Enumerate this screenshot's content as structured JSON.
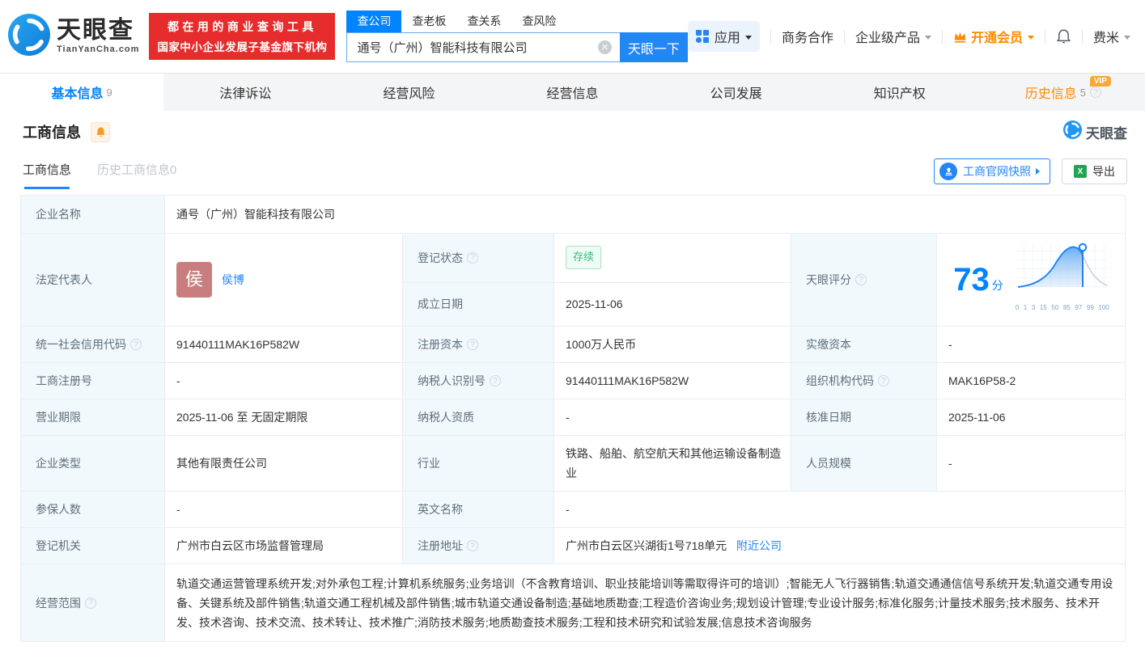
{
  "header": {
    "logo": {
      "brand": "天眼查",
      "domain": "TianYanCha.com"
    },
    "promo": {
      "line1": "都在用的商业查询工具",
      "line2": "国家中小企业发展子基金旗下机构"
    },
    "search": {
      "tabs": [
        {
          "label": "查公司"
        },
        {
          "label": "查老板"
        },
        {
          "label": "查关系"
        },
        {
          "label": "查风险"
        }
      ],
      "input_value": "通号（广州）智能科技有限公司",
      "button_label": "天眼一下"
    },
    "menu": {
      "apps": "应用",
      "cooperation": "商务合作",
      "enterprise": "企业级产品",
      "vip": "开通会员",
      "username": "费米"
    }
  },
  "nav_tabs": [
    {
      "label": "基本信息",
      "count": "9"
    },
    {
      "label": "法律诉讼"
    },
    {
      "label": "经营风险"
    },
    {
      "label": "经营信息"
    },
    {
      "label": "公司发展"
    },
    {
      "label": "知识产权"
    },
    {
      "label": "历史信息",
      "count": "5",
      "vip_badge": "VIP"
    }
  ],
  "section": {
    "title": "工商信息",
    "watermark": "天眼查",
    "subtabs": [
      {
        "label": "工商信息"
      },
      {
        "label": "历史工商信息0"
      }
    ],
    "snapshot_button": "工商官网快照",
    "export_button": "导出"
  },
  "table": {
    "company_name": {
      "label": "企业名称",
      "value": "通号（广州）智能科技有限公司"
    },
    "legal_rep": {
      "label": "法定代表人",
      "avatar": "侯",
      "name": "侯博"
    },
    "reg_status": {
      "label": "登记状态",
      "value": "存续"
    },
    "est_date": {
      "label": "成立日期",
      "value": "2025-11-06"
    },
    "score": {
      "label": "天眼评分",
      "value": "73",
      "unit": "分",
      "axis": [
        "0",
        "1",
        "3",
        "15",
        "50",
        "85",
        "97",
        "99",
        "100"
      ]
    },
    "uscc": {
      "label": "统一社会信用代码",
      "value": "91440111MAK16P582W"
    },
    "reg_capital": {
      "label": "注册资本",
      "value": "1000万人民币"
    },
    "paid_capital": {
      "label": "实缴资本",
      "value": "-"
    },
    "reg_number": {
      "label": "工商注册号",
      "value": "-"
    },
    "taxpayer_id": {
      "label": "纳税人识别号",
      "value": "91440111MAK16P582W"
    },
    "org_code": {
      "label": "组织机构代码",
      "value": "MAK16P58-2"
    },
    "business_term": {
      "label": "营业期限",
      "value": "2025-11-06 至 无固定期限"
    },
    "taxpayer_quality": {
      "label": "纳税人资质",
      "value": "-"
    },
    "approval_date": {
      "label": "核准日期",
      "value": "2025-11-06"
    },
    "company_type": {
      "label": "企业类型",
      "value": "其他有限责任公司"
    },
    "industry": {
      "label": "行业",
      "value": "铁路、船舶、航空航天和其他运输设备制造业"
    },
    "staff_size": {
      "label": "人员规模",
      "value": "-"
    },
    "insured_count": {
      "label": "参保人数",
      "value": "-"
    },
    "english_name": {
      "label": "英文名称",
      "value": "-"
    },
    "reg_authority": {
      "label": "登记机关",
      "value": "广州市白云区市场监督管理局"
    },
    "reg_address": {
      "label": "注册地址",
      "value": "广州市白云区兴湖街1号718单元",
      "nearby_link": "附近公司"
    },
    "business_scope": {
      "label": "经营范围",
      "value": "轨道交通运营管理系统开发;对外承包工程;计算机系统服务;业务培训（不含教育培训、职业技能培训等需取得许可的培训）;智能无人飞行器销售;轨道交通通信信号系统开发;轨道交通专用设备、关键系统及部件销售;轨道交通工程机械及部件销售;城市轨道交通设备制造;基础地质勘查;工程造价咨询业务;规划设计管理;专业设计服务;标准化服务;计量技术服务;技术服务、技术开发、技术咨询、技术交流、技术转让、技术推广;消防技术服务;地质勘查技术服务;工程和技术研究和试验发展;信息技术咨询服务"
    }
  },
  "colors": {
    "brand_blue": "#0084ff",
    "link_blue": "#2286f5",
    "promo_red": "#e62c2c",
    "vip_orange": "#ff8a00",
    "status_green": "#31bd78"
  }
}
